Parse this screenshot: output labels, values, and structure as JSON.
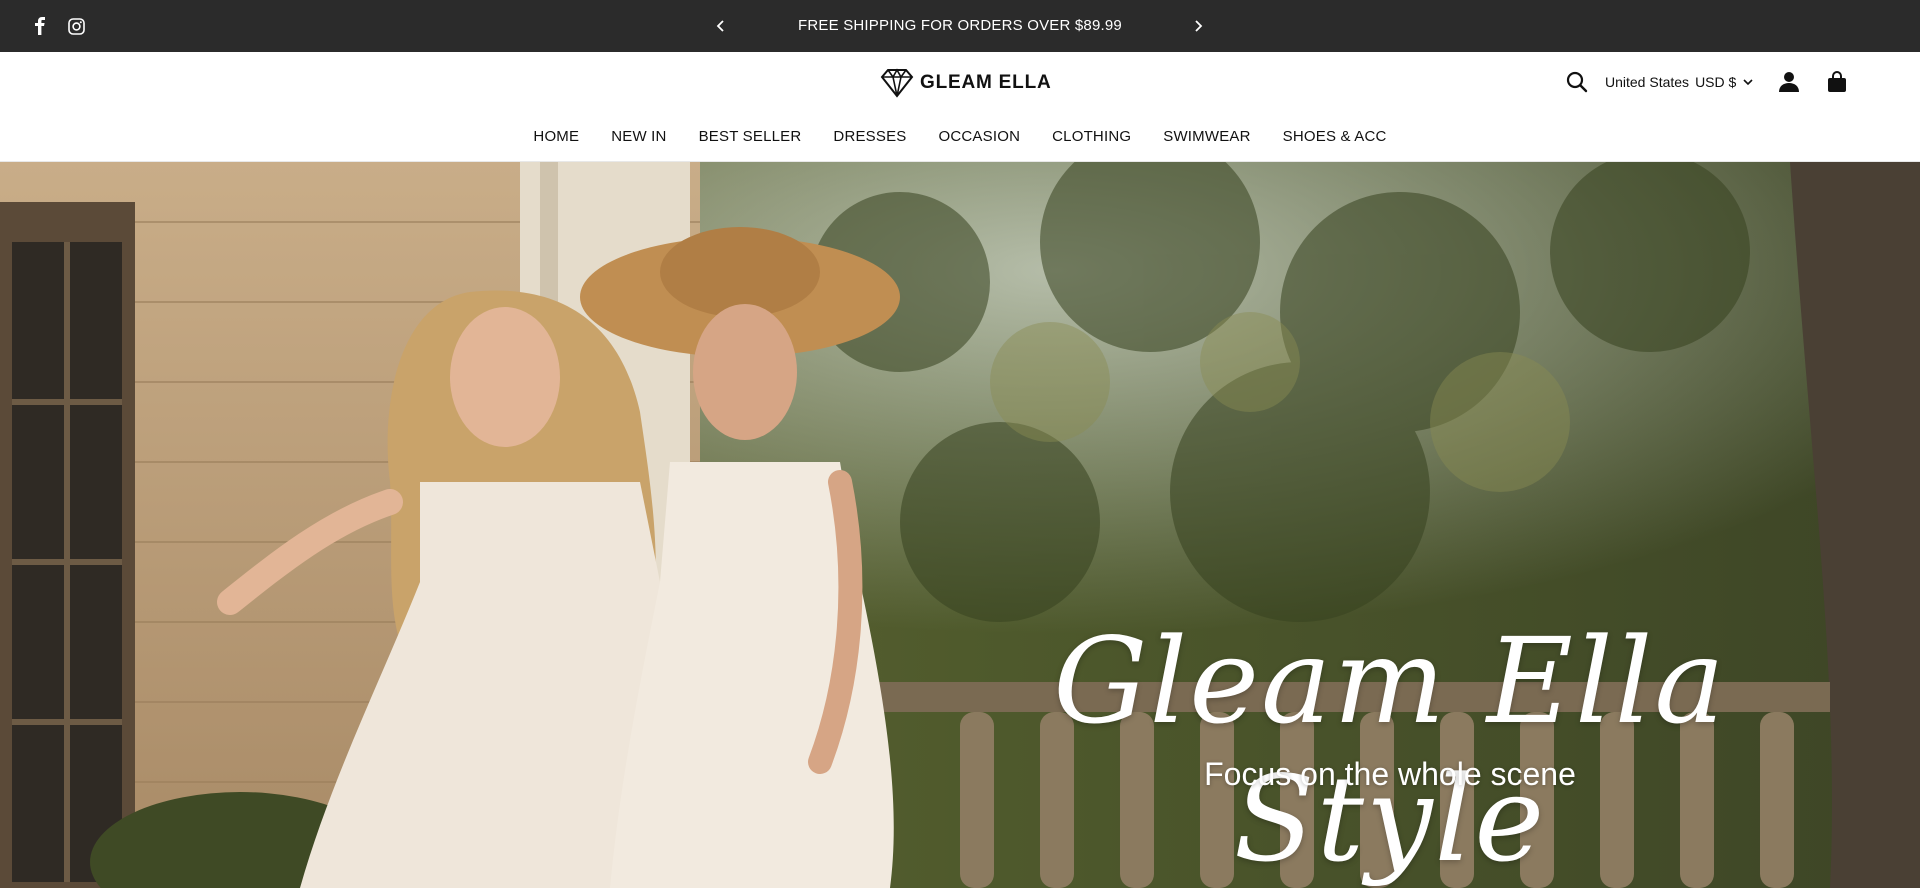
{
  "announcement": {
    "message": "FREE SHIPPING FOR ORDERS OVER $89.99"
  },
  "social": [
    "facebook-icon",
    "instagram-icon"
  ],
  "brand": {
    "name": "GLEAM ELLA"
  },
  "header": {
    "country": "United States",
    "currency": "USD $"
  },
  "nav": [
    "HOME",
    "NEW IN",
    "BEST SELLER",
    "DRESSES",
    "OCCASION",
    "CLOTHING",
    "SWIMWEAR",
    "SHOES & ACC"
  ],
  "hero": {
    "title": "Gleam Ella Style",
    "subtitle": "Focus on the whole scene"
  },
  "colors": {
    "announcement_bg": "#2b2b2b",
    "text": "#111111",
    "hero_text": "#ffffff"
  }
}
